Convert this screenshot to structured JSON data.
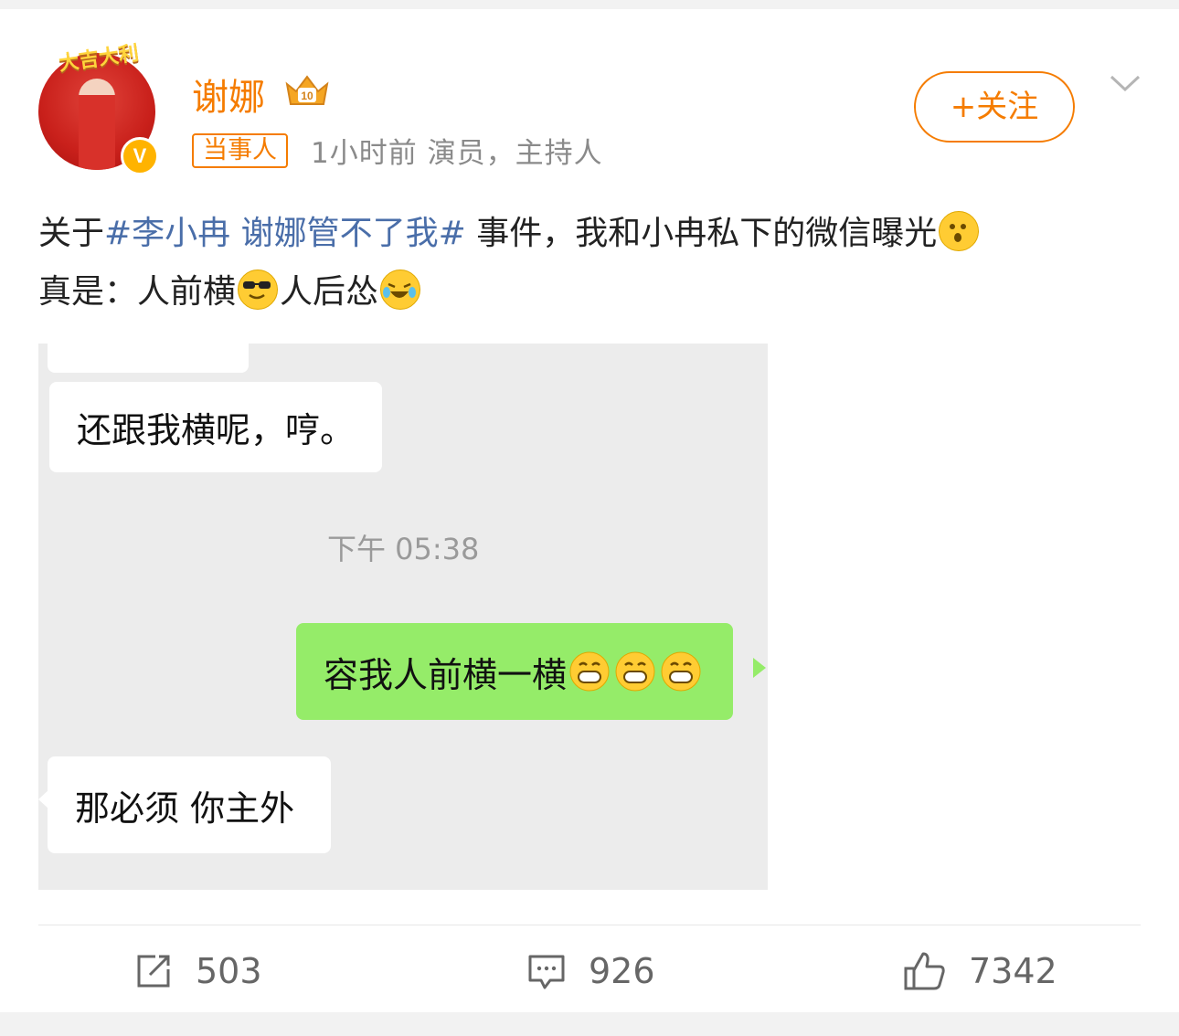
{
  "user": {
    "name": "谢娜",
    "tag": "当事人",
    "meta": "1小时前  演员，主持人",
    "verified_badge": "V",
    "avatar_banner": "大吉大利"
  },
  "follow_button": {
    "label": "+关注"
  },
  "post": {
    "text_before": "关于",
    "hashtag": "#李小冉 谢娜管不了我#",
    "text_after": " 事件，我和小冉私下的微信曝光",
    "line2_a": "真是：人前横",
    "line2_b": "人后怂"
  },
  "chat": {
    "msg1": "还跟我横呢，哼。",
    "timestamp": "下午 05:38",
    "msg2": "容我人前横一横",
    "msg3": "那必须 你主外"
  },
  "actions": {
    "repost_count": "503",
    "comment_count": "926",
    "like_count": "7342"
  },
  "colors": {
    "accent": "#f57c00",
    "hashtag": "#4a6ea9",
    "wechat_green": "#95ec69"
  },
  "icons": [
    "verified-v-icon",
    "crown-badge-icon",
    "chevron-down-icon",
    "shush-emoji",
    "sunglasses-emoji",
    "laugh-cry-emoji",
    "grin-emoji",
    "repost-icon",
    "comment-icon",
    "thumbs-up-icon"
  ]
}
